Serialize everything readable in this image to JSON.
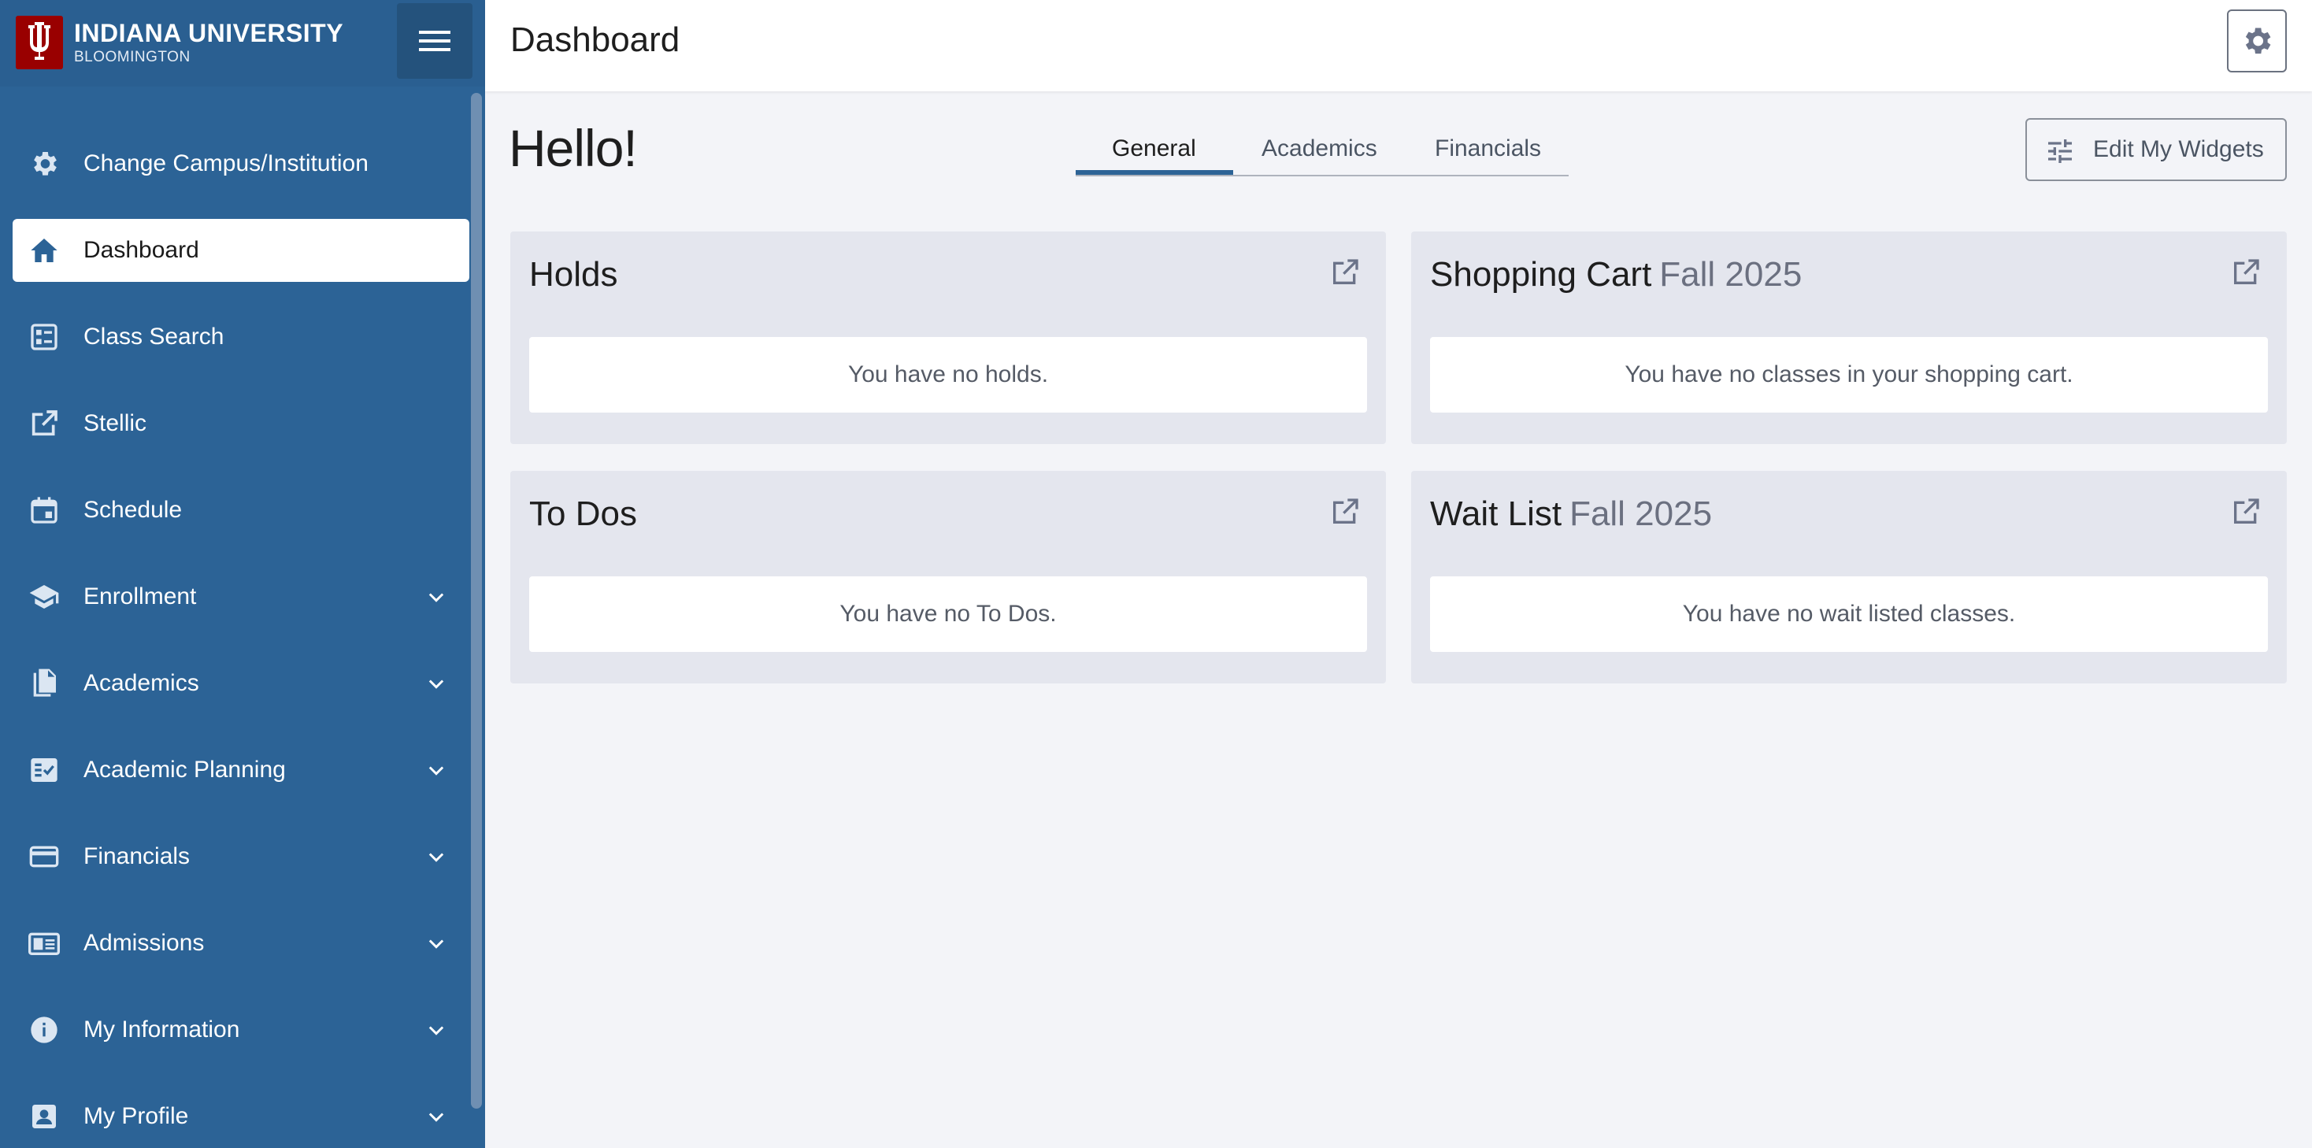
{
  "brand": {
    "name": "INDIANA UNIVERSITY",
    "sub": "BLOOMINGTON"
  },
  "sidebar": {
    "items": [
      {
        "label": "Change Campus/Institution",
        "icon": "gear-icon",
        "expandable": false
      },
      {
        "label": "Dashboard",
        "icon": "home-icon",
        "expandable": false,
        "active": true
      },
      {
        "label": "Class Search",
        "icon": "class-search-icon",
        "expandable": false
      },
      {
        "label": "Stellic",
        "icon": "external-link-icon",
        "expandable": false
      },
      {
        "label": "Schedule",
        "icon": "calendar-icon",
        "expandable": false
      },
      {
        "label": "Enrollment",
        "icon": "graduation-cap-icon",
        "expandable": true
      },
      {
        "label": "Academics",
        "icon": "documents-icon",
        "expandable": true
      },
      {
        "label": "Academic Planning",
        "icon": "checklist-icon",
        "expandable": true
      },
      {
        "label": "Financials",
        "icon": "credit-card-icon",
        "expandable": true
      },
      {
        "label": "Admissions",
        "icon": "id-card-icon",
        "expandable": true
      },
      {
        "label": "My Information",
        "icon": "info-icon",
        "expandable": true
      },
      {
        "label": "My Profile",
        "icon": "profile-icon",
        "expandable": true
      }
    ]
  },
  "header": {
    "title": "Dashboard"
  },
  "main": {
    "greeting": "Hello!",
    "tabs": [
      {
        "label": "General",
        "active": true
      },
      {
        "label": "Academics",
        "active": false
      },
      {
        "label": "Financials",
        "active": false
      }
    ],
    "edit_widgets_label": "Edit My Widgets",
    "cards": [
      {
        "title": "Holds",
        "term": "",
        "message": "You have no holds."
      },
      {
        "title": "Shopping Cart",
        "term": "Fall 2025",
        "message": "You have no classes in your shopping cart."
      },
      {
        "title": "To Dos",
        "term": "",
        "message": "You have no To Dos."
      },
      {
        "title": "Wait List",
        "term": "Fall 2025",
        "message": "You have no wait listed classes."
      }
    ]
  },
  "colors": {
    "sidebar": "#2c6396",
    "brand_red": "#990000",
    "accent": "#2c6396",
    "page_bg": "#f3f4f8",
    "card_bg": "#e4e6ee"
  }
}
